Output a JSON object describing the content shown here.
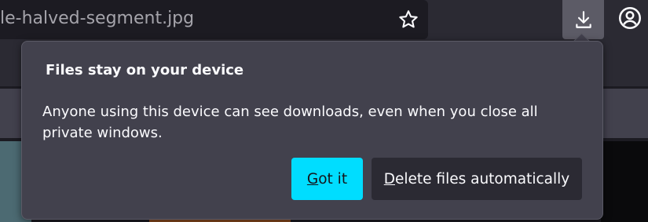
{
  "browser": {
    "url_text": "le-halved-segment.jpg",
    "icons": {
      "bookmark": "star-icon",
      "downloads": "download-icon",
      "account": "account-icon"
    }
  },
  "panel": {
    "title": "Files stay on your device",
    "body": "Anyone using this device can see downloads, even when you close all private windows.",
    "primary_button": {
      "accesskey": "G",
      "rest": "ot it"
    },
    "secondary_button": {
      "accesskey": "D",
      "rest": "elete files automatically"
    }
  },
  "colors": {
    "accent": "#00ddff",
    "panel_bg": "#42414d",
    "toolbar_bg": "#2b2a33",
    "text": "#fbfbfe"
  }
}
